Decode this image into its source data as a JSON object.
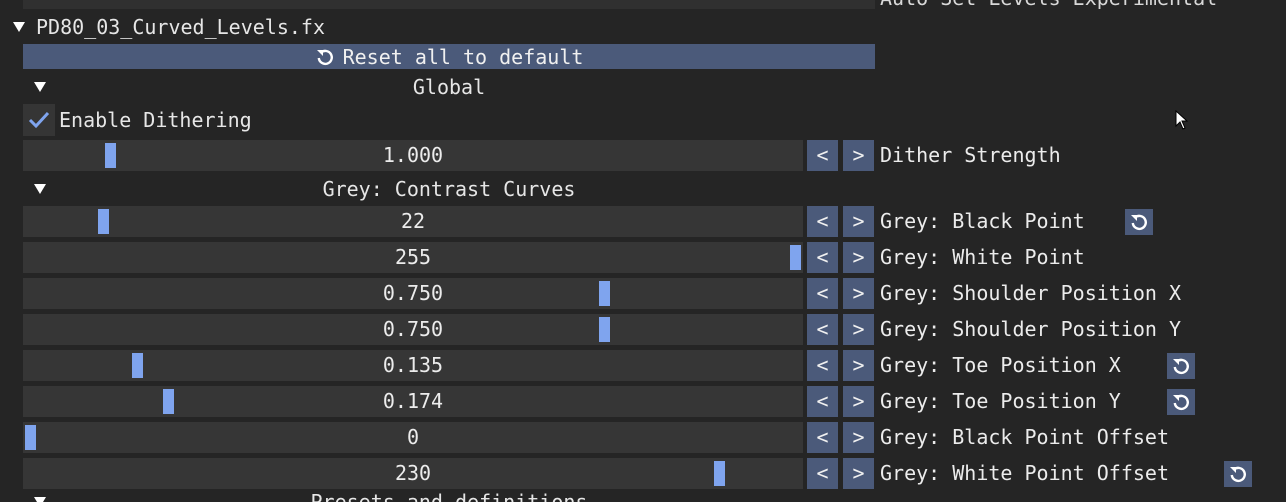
{
  "top_strip": {
    "right_text": "Auto_Set_Levels_Experimental"
  },
  "effect": {
    "title": "PD80_03_Curved_Levels.fx"
  },
  "reset_all_label": "Reset all to default",
  "sections": {
    "global": "Global",
    "grey_contrast": "Grey: Contrast Curves",
    "next_partial": "Presets and definitions"
  },
  "dithering": {
    "label": "Enable Dithering",
    "checked": true
  },
  "step_labels": {
    "dec": "<",
    "inc": ">"
  },
  "params": [
    {
      "value": "1.000",
      "label": "Dither Strength",
      "fraction": 0.105,
      "modified": false
    },
    {
      "value": "22",
      "label": "Grey: Black Point",
      "fraction": 0.095,
      "modified": true
    },
    {
      "value": "255",
      "label": "Grey: White Point",
      "fraction": 1.0,
      "modified": false
    },
    {
      "value": "0.750",
      "label": "Grey: Shoulder Position X",
      "fraction": 0.75,
      "modified": false
    },
    {
      "value": "0.750",
      "label": "Grey: Shoulder Position Y",
      "fraction": 0.75,
      "modified": false
    },
    {
      "value": "0.135",
      "label": "Grey: Toe Position X",
      "fraction": 0.14,
      "modified": true
    },
    {
      "value": "0.174",
      "label": "Grey: Toe Position Y",
      "fraction": 0.18,
      "modified": true
    },
    {
      "value": "0",
      "label": "Grey: Black Point Offset",
      "fraction": 0.0,
      "modified": false
    },
    {
      "value": "230",
      "label": "Grey: White Point Offset",
      "fraction": 0.9,
      "modified": true
    }
  ],
  "colors": {
    "background": "#252525",
    "frame": "#363636",
    "button": "#4b5a7a",
    "grab": "#7fa4ee",
    "check": "#7fa4ee"
  }
}
